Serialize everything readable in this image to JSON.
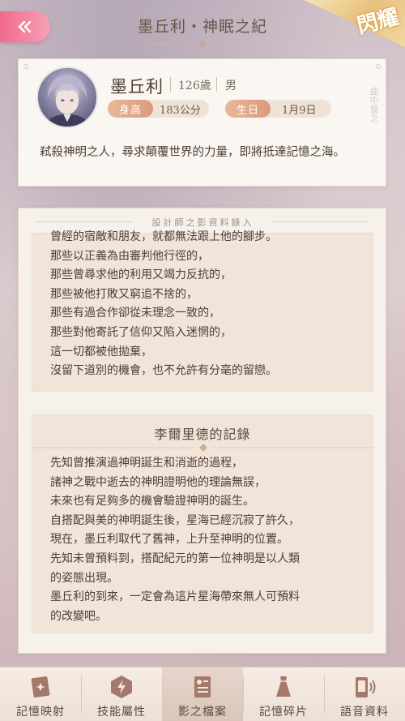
{
  "header": {
    "title": "墨丘利・神眠之紀",
    "badge": "閃耀"
  },
  "profile": {
    "name": "墨丘利",
    "age": "126歲",
    "gender": "男",
    "height_label": "身高",
    "height_value": "183公分",
    "birthday_label": "生日",
    "birthday_value": "1月9日",
    "side_text": "曲中曾之",
    "description": "弒殺神明之人，尋求顛覆世界的力量，即將抵達記憶之海。"
  },
  "record": {
    "panel_header": "設計師之影資料錄入",
    "section1_lines": [
      "曾經的宿敵和朋友，就都無法跟上他的腳步。",
      "那些以正義為由審判他行徑的，",
      "那些曾尋求他的利用又竭力反抗的，",
      "那些被他打敗又窮追不捨的，",
      "那些有過合作卻從未理念一致的，",
      "那些對他寄託了信仰又陷入迷惘的，",
      "這一切都被他拋棄，",
      "沒留下道別的機會，也不允許有分毫的留戀。"
    ],
    "section2_title": "李爾里德的記錄",
    "section2_lines": [
      "先知曾推演過神明誕生和消逝的過程，",
      "諸神之戰中逝去的神明證明他的理論無誤，",
      "未來也有足夠多的機會驗證神明的誕生。",
      "自搭配與美的神明誕生後，星海已經沉寂了許久，",
      "現在，墨丘利取代了舊神，上升至神明的位置。",
      "先知未曾預料到，搭配紀元的第一位神明是以人類",
      "的姿態出現。",
      "墨丘利的到來，一定會為這片星海帶來無人可預料",
      "的改變吧。"
    ]
  },
  "nav": {
    "items": [
      {
        "label": "記憶映射",
        "icon": "memory-card-icon"
      },
      {
        "label": "技能屬性",
        "icon": "lightning-icon"
      },
      {
        "label": "影之檔案",
        "icon": "file-profile-icon"
      },
      {
        "label": "記憶碎片",
        "icon": "dress-icon"
      },
      {
        "label": "語音資料",
        "icon": "phone-voice-icon"
      }
    ],
    "active_index": 2
  },
  "colors": {
    "accent_pink": "#f06a8c",
    "pill_label": "#d99a7c",
    "text_main": "#4e3e36"
  }
}
